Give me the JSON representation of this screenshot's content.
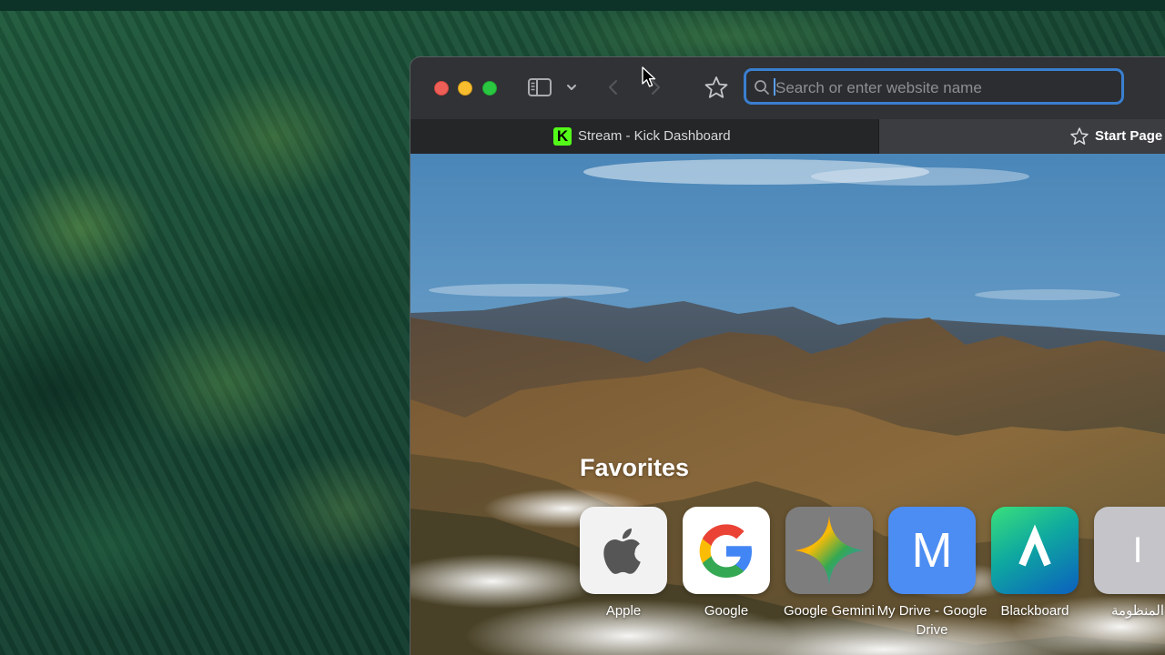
{
  "toolbar": {
    "address_placeholder": "Search or enter website name",
    "address_value": ""
  },
  "tabs": [
    {
      "title": "Stream - Kick Dashboard",
      "favicon_letter": "K",
      "active": true
    },
    {
      "title": "Start Page",
      "active": false
    }
  ],
  "start_page": {
    "favorites_title": "Favorites",
    "favorites": [
      {
        "label": "Apple",
        "icon": "apple-logo-icon"
      },
      {
        "label": "Google",
        "icon": "google-g-icon"
      },
      {
        "label": "Google Gemini",
        "icon": "gemini-sparkle-icon"
      },
      {
        "label": "My Drive - Google Drive",
        "glyph": "M"
      },
      {
        "label": "Blackboard",
        "icon": "blackboard-logo-icon"
      },
      {
        "label": "المنظومة",
        "glyph": "I"
      }
    ]
  },
  "colors": {
    "address_focus": "#3a7fd0",
    "close": "#ee5f58",
    "minimize": "#f8bd2f",
    "maximize": "#2ac840",
    "kick_green": "#53fc18"
  }
}
